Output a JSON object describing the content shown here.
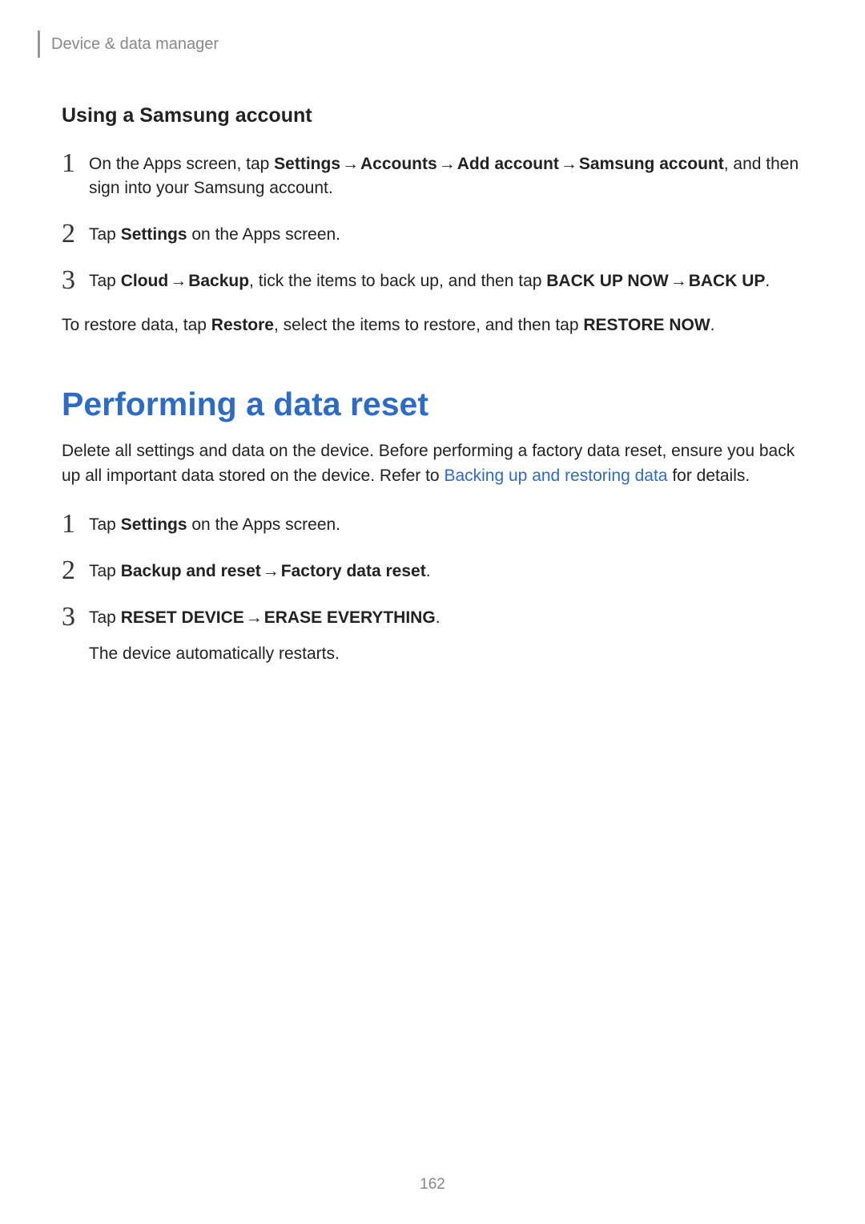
{
  "header": {
    "breadcrumb": "Device & data manager"
  },
  "section1": {
    "title": "Using a Samsung account",
    "steps": {
      "s1": {
        "num": "1",
        "pre": "On the Apps screen, tap ",
        "b1": "Settings",
        "b2": "Accounts",
        "b3": "Add account",
        "b4": "Samsung account",
        "post": ", and then sign into your Samsung account."
      },
      "s2": {
        "num": "2",
        "pre": "Tap ",
        "b1": "Settings",
        "post": " on the Apps screen."
      },
      "s3": {
        "num": "3",
        "pre": "Tap ",
        "b1": "Cloud",
        "b2": "Backup",
        "mid": ", tick the items to back up, and then tap ",
        "b3": "BACK UP NOW",
        "b4": "BACK UP",
        "post": "."
      }
    },
    "restore": {
      "pre": "To restore data, tap ",
      "b1": "Restore",
      "mid": ", select the items to restore, and then tap ",
      "b2": "RESTORE NOW",
      "post": "."
    }
  },
  "section2": {
    "title": "Performing a data reset",
    "intro": {
      "pre": "Delete all settings and data on the device. Before performing a factory data reset, ensure you back up all important data stored on the device. Refer to ",
      "link": "Backing up and restoring data",
      "post": " for details."
    },
    "steps": {
      "s1": {
        "num": "1",
        "pre": "Tap ",
        "b1": "Settings",
        "post": " on the Apps screen."
      },
      "s2": {
        "num": "2",
        "pre": "Tap ",
        "b1": "Backup and reset",
        "b2": "Factory data reset",
        "post": "."
      },
      "s3": {
        "num": "3",
        "pre": "Tap ",
        "b1": "RESET DEVICE",
        "b2": "ERASE EVERYTHING",
        "post": ".",
        "follow": "The device automatically restarts."
      }
    }
  },
  "arrow": "→",
  "pageNumber": "162"
}
